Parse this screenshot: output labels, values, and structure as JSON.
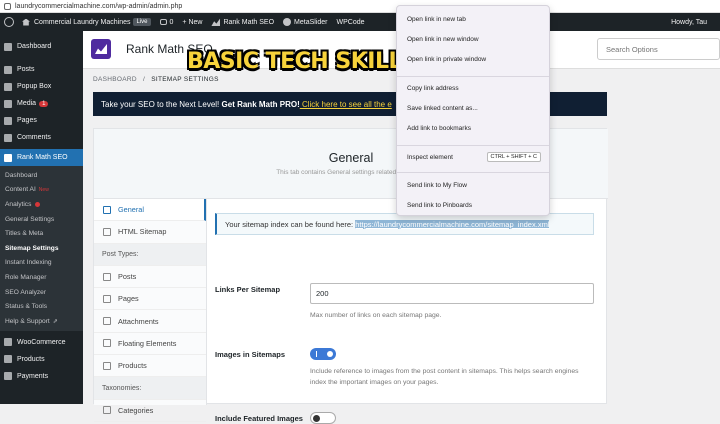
{
  "browser": {
    "url": "laundrycommercialmachine.com/wp-admin/admin.php"
  },
  "admin_bar": {
    "site_name": "Commercial Laundry Machines",
    "live_badge": "Live",
    "comments_count": "0",
    "new_label": "+ New",
    "rank_math": "Rank Math SEO",
    "meta_slider": "MetaSlider",
    "wpcode": "WPCode",
    "howdy": "Howdy, Tau"
  },
  "sidebar": {
    "top_items": [
      {
        "label": "Dashboard",
        "icon": "dashboard-icon"
      },
      {
        "label": "Posts",
        "icon": "pin-icon"
      },
      {
        "label": "Popup Box",
        "icon": "popup-icon"
      },
      {
        "label": "Media",
        "icon": "media-icon",
        "badge": "1"
      },
      {
        "label": "Pages",
        "icon": "page-icon"
      },
      {
        "label": "Comments",
        "icon": "comment-icon"
      }
    ],
    "active": {
      "label": "Rank Math SEO",
      "icon": "rank-math-icon"
    },
    "submenu": [
      {
        "label": "Dashboard"
      },
      {
        "label": "Content AI",
        "tag": "New"
      },
      {
        "label": "Analytics"
      },
      {
        "label": "General Settings"
      },
      {
        "label": "Titles & Meta"
      },
      {
        "label": "Sitemap Settings"
      },
      {
        "label": "Instant Indexing"
      },
      {
        "label": "Role Manager"
      },
      {
        "label": "SEO Analyzer"
      },
      {
        "label": "Status & Tools"
      },
      {
        "label": "Help & Support"
      }
    ],
    "bottom_items": [
      {
        "label": "WooCommerce",
        "icon": "woo-icon"
      },
      {
        "label": "Products",
        "icon": "product-icon"
      },
      {
        "label": "Payments",
        "icon": "payments-icon"
      }
    ]
  },
  "header": {
    "title": "Rank Math SEO",
    "search_placeholder": "Search Options"
  },
  "overlay": {
    "text": "BASIC TECH SKILLS"
  },
  "breadcrumb": {
    "root": "DASHBOARD",
    "sep": "/",
    "current": "SITEMAP SETTINGS"
  },
  "promo": {
    "text": "Take your SEO to the Next Level! ",
    "bold": "Get Rank Math PRO!",
    "link": " Click here to see all the e"
  },
  "card": {
    "title": "General",
    "subtitle": "This tab contains General settings related to the XM"
  },
  "tabs": [
    {
      "label": "General",
      "active": true
    },
    {
      "label": "HTML Sitemap"
    },
    {
      "label": "Post Types:",
      "group": true
    },
    {
      "label": "Posts"
    },
    {
      "label": "Pages"
    },
    {
      "label": "Attachments"
    },
    {
      "label": "Floating Elements"
    },
    {
      "label": "Products"
    },
    {
      "label": "Taxonomies:",
      "group": true
    },
    {
      "label": "Categories"
    }
  ],
  "settings": {
    "sitemap_notice": "Your sitemap index can be found here: ",
    "sitemap_link": "https://laundrycommercialmachine.com/sitemap_index.xml",
    "links_per_sitemap": {
      "label": "Links Per Sitemap",
      "value": "200",
      "help": "Max number of links on each sitemap page."
    },
    "images_in_sitemaps": {
      "label": "Images in Sitemaps",
      "on": true,
      "help": "Include reference to images from the post content in sitemaps. This helps search engines index the important images on your pages."
    },
    "featured_images": {
      "label": "Include Featured Images",
      "on": false
    }
  },
  "context_menu": {
    "items": [
      {
        "label": "Open link in new tab"
      },
      {
        "label": "Open link in new window"
      },
      {
        "label": "Open link in private window"
      },
      {
        "label": "Copy link address"
      },
      {
        "label": "Save linked content as..."
      },
      {
        "label": "Add link to bookmarks"
      },
      {
        "label": "Inspect element",
        "shortcut": "CTRL + SHIFT + C"
      },
      {
        "label": "Send link to My Flow"
      },
      {
        "label": "Send link to Pinboards"
      }
    ]
  }
}
